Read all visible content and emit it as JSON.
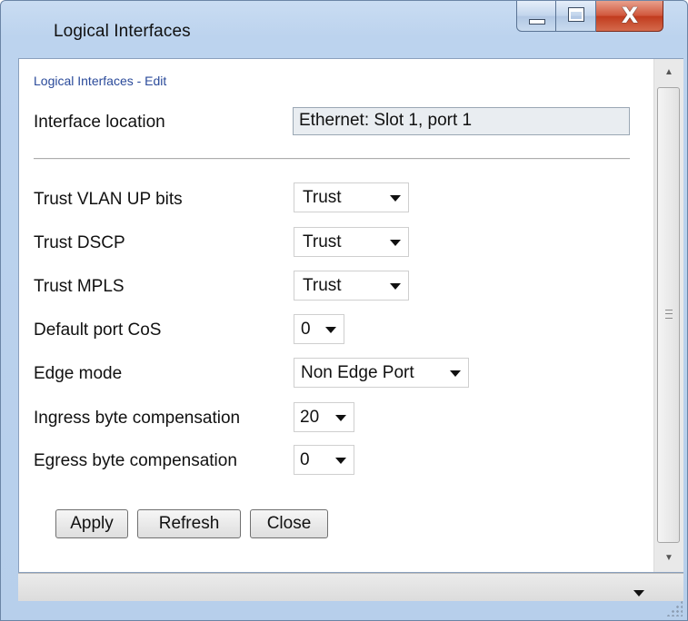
{
  "window": {
    "title": "Logical Interfaces",
    "close_glyph": "X"
  },
  "breadcrumb": "Logical Interfaces - Edit",
  "interface_location": {
    "label": "Interface location",
    "value": "Ethernet: Slot 1, port 1"
  },
  "fields": [
    {
      "label": "Trust VLAN UP bits",
      "value": "Trust"
    },
    {
      "label": "Trust DSCP",
      "value": "Trust"
    },
    {
      "label": "Trust MPLS",
      "value": "Trust"
    },
    {
      "label": "Default port CoS",
      "value": "0"
    },
    {
      "label": "Edge mode",
      "value": "Non Edge Port"
    },
    {
      "label": "Ingress byte compensation",
      "value": "20"
    },
    {
      "label": "Egress byte compensation",
      "value": "0"
    }
  ],
  "buttons": {
    "apply": "Apply",
    "refresh": "Refresh",
    "close": "Close"
  },
  "icons": {
    "minimize": "minimize-icon",
    "maximize": "maximize-icon",
    "close": "close-icon",
    "dropdown": "chevron-down-icon",
    "resize": "resize-grip-icon"
  }
}
